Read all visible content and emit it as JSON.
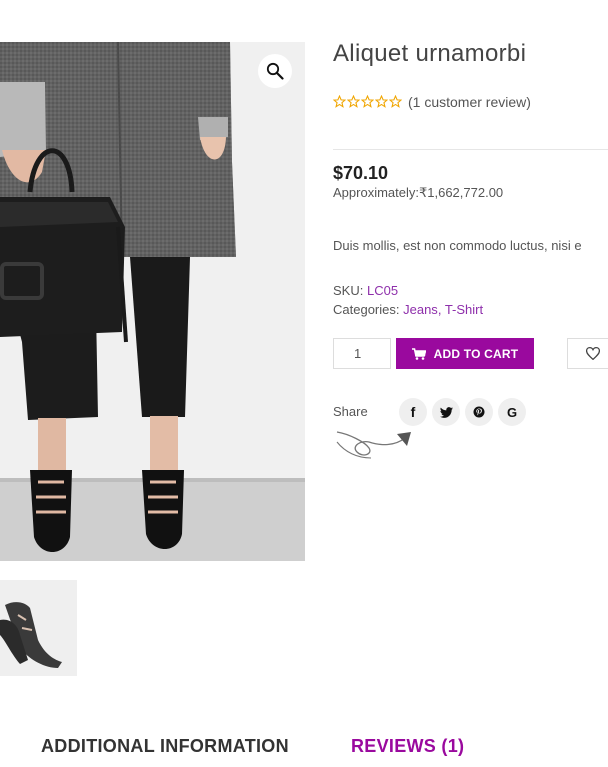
{
  "product": {
    "title": "Aliquet urnamorbi",
    "rating": 0,
    "rating_max": 5,
    "review_link": "(1 customer review)",
    "price": "$70.10",
    "approx": "Approximately:₹1,662,772.00",
    "description": "Duis mollis, est non commodo luctus, nisi e",
    "sku_label": "SKU:",
    "sku_value": "LC05",
    "categories_label": "Categories:",
    "category_1": "Jeans",
    "category_sep": ",",
    "category_2": "T-Shirt",
    "quantity": "1",
    "add_to_cart": "ADD TO CART",
    "share_label": "Share"
  },
  "share_icons": [
    "facebook-icon",
    "twitter-icon",
    "pinterest-icon",
    "google-icon"
  ],
  "share_glyphs": {
    "facebook": "f",
    "google": "G"
  },
  "tabs": {
    "additional": "ADDITIONAL INFORMATION",
    "reviews": "REVIEWS (1)"
  },
  "colors": {
    "accent": "#9a099e",
    "link": "#8e2fab",
    "star": "#f0a500"
  }
}
